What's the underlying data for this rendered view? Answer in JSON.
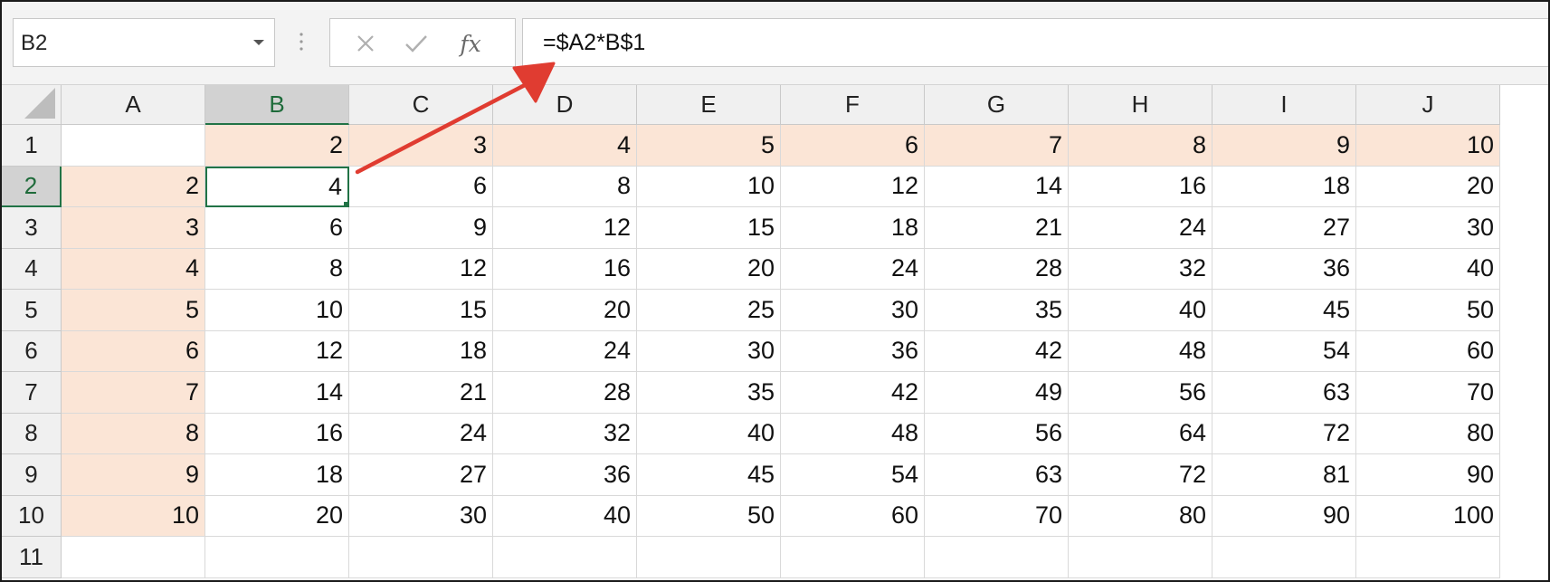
{
  "name_box": {
    "value": "B2"
  },
  "formula_bar": {
    "formula": "=$A2*B$1",
    "fx_label": "fx"
  },
  "icons": {
    "cancel": "close-icon",
    "enter": "checkmark-icon",
    "dropdown": "chevron-down-icon"
  },
  "colors": {
    "accent": "#217346",
    "highlight": "#fbe5d6",
    "arrow": "#e03c31"
  },
  "columns": [
    "A",
    "B",
    "C",
    "D",
    "E",
    "F",
    "G",
    "H",
    "I",
    "J"
  ],
  "rows": [
    "1",
    "2",
    "3",
    "4",
    "5",
    "6",
    "7",
    "8",
    "9",
    "10",
    "11"
  ],
  "cells": [
    [
      "",
      "2",
      "3",
      "4",
      "5",
      "6",
      "7",
      "8",
      "9",
      "10"
    ],
    [
      "2",
      "4",
      "6",
      "8",
      "10",
      "12",
      "14",
      "16",
      "18",
      "20"
    ],
    [
      "3",
      "6",
      "9",
      "12",
      "15",
      "18",
      "21",
      "24",
      "27",
      "30"
    ],
    [
      "4",
      "8",
      "12",
      "16",
      "20",
      "24",
      "28",
      "32",
      "36",
      "40"
    ],
    [
      "5",
      "10",
      "15",
      "20",
      "25",
      "30",
      "35",
      "40",
      "45",
      "50"
    ],
    [
      "6",
      "12",
      "18",
      "24",
      "30",
      "36",
      "42",
      "48",
      "54",
      "60"
    ],
    [
      "7",
      "14",
      "21",
      "28",
      "35",
      "42",
      "49",
      "56",
      "63",
      "70"
    ],
    [
      "8",
      "16",
      "24",
      "32",
      "40",
      "48",
      "56",
      "64",
      "72",
      "80"
    ],
    [
      "9",
      "18",
      "27",
      "36",
      "45",
      "54",
      "63",
      "72",
      "81",
      "90"
    ],
    [
      "10",
      "20",
      "30",
      "40",
      "50",
      "60",
      "70",
      "80",
      "90",
      "100"
    ],
    [
      "",
      "",
      "",
      "",
      "",
      "",
      "",
      "",
      "",
      ""
    ]
  ],
  "selection": {
    "cell": "B2"
  }
}
